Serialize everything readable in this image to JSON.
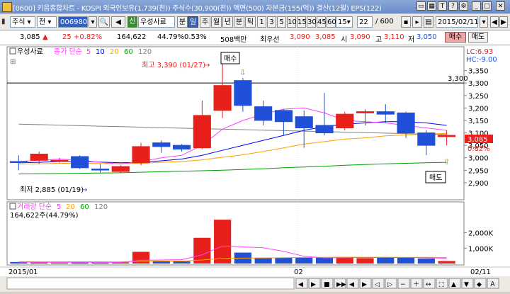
{
  "window": {
    "title": "[0600] 키움종합차트 - KOSPI 외국인보유(1,739(천)) 주식수(30,900(천)) 액면(500) 자본금(155(억)) 결산(12월) EPS(122)"
  },
  "toolbar": {
    "market": "주식",
    "prev": "전",
    "code": "006980",
    "new_badge": "신",
    "name": "우성사료",
    "period_minute": "분",
    "period_day": "일",
    "period_week": "주",
    "period_month": "월",
    "period_year": "년",
    "period_minute2": "분",
    "period_tick": "틱",
    "intervals": [
      "1",
      "3",
      "5",
      "10",
      "15",
      "30",
      "45",
      "60"
    ],
    "interval_value": "15",
    "count": "22",
    "total": "/ 600",
    "date": "2015/02/11"
  },
  "quote": {
    "price": "3,085",
    "change": "25",
    "change_pct": "+0.82%",
    "volume": "164,622",
    "vol_ratio": "44.79%",
    "turnover": "0.53%",
    "amount": "508백만",
    "bid_label": "최우선",
    "ask": "3,090",
    "bid": "3,085",
    "open_label": "시",
    "open": "3,090",
    "high_label": "고",
    "high": "3,110",
    "low_label": "저",
    "low": "3,050",
    "buy_button": "매수",
    "sell_button": "매도"
  },
  "price_panel": {
    "stock_label": "우성사료",
    "legend_prefix": "종가 단순",
    "ma_labels": [
      "5",
      "10",
      "20",
      "60",
      "120"
    ],
    "ma_colors": [
      "#ff40ff",
      "#0000ff",
      "#ffa000",
      "#00a000",
      "#808080"
    ],
    "lc": "LC:6.93",
    "hc": "HC:-9.00",
    "y_ticks": [
      "3,350",
      "3,300",
      "3,250",
      "3,200",
      "3,150",
      "3,100",
      "3,050",
      "3,000",
      "2,950",
      "2,900"
    ],
    "hline_label": "3,300",
    "high_note": "최고 3,390 (01/27)",
    "low_note": "최저 2,885 (01/19)",
    "buy_marker": "매수",
    "sell_marker": "매도",
    "current_price_tag": "3,085",
    "current_pct_tag": "0.82%"
  },
  "volume_panel": {
    "title": "거래량 단순",
    "ma_labels": [
      "5",
      "20",
      "60",
      "120"
    ],
    "ma_colors": [
      "#ff40ff",
      "#ffa000",
      "#00a000",
      "#808080"
    ],
    "info": "164,622주(44.79%)",
    "y_ticks": [
      "2,000K",
      "1,000K"
    ]
  },
  "x_axis": {
    "labels": [
      "2015/01",
      "02",
      "02/11"
    ]
  },
  "colors": {
    "up": "#e8201c",
    "down": "#2050d8",
    "accent": "#3a62b0"
  },
  "chart_data": {
    "type": "candlestick",
    "candles": [
      {
        "o": 2985,
        "h": 3010,
        "l": 2950,
        "c": 2985,
        "up": false
      },
      {
        "o": 2990,
        "h": 3025,
        "l": 2975,
        "c": 3015,
        "up": true
      },
      {
        "o": 2990,
        "h": 3000,
        "l": 2980,
        "c": 2990,
        "up": true
      },
      {
        "o": 3005,
        "h": 3010,
        "l": 2955,
        "c": 2960,
        "up": false
      },
      {
        "o": 2955,
        "h": 2975,
        "l": 2940,
        "c": 2955,
        "up": false
      },
      {
        "o": 2945,
        "h": 2970,
        "l": 2938,
        "c": 2965,
        "up": true
      },
      {
        "o": 2980,
        "h": 3060,
        "l": 2970,
        "c": 3045,
        "up": true
      },
      {
        "o": 3045,
        "h": 3070,
        "l": 3020,
        "c": 3060,
        "up": false
      },
      {
        "o": 3050,
        "h": 3055,
        "l": 3025,
        "c": 3035,
        "up": false
      },
      {
        "o": 3040,
        "h": 3230,
        "l": 3035,
        "c": 3170,
        "up": true
      },
      {
        "o": 3190,
        "h": 3390,
        "l": 3160,
        "c": 3290,
        "up": true
      },
      {
        "o": 3310,
        "h": 3320,
        "l": 3185,
        "c": 3210,
        "up": false
      },
      {
        "o": 3205,
        "h": 3230,
        "l": 3130,
        "c": 3150,
        "up": false
      },
      {
        "o": 3190,
        "h": 3195,
        "l": 3090,
        "c": 3145,
        "up": false
      },
      {
        "o": 3165,
        "h": 3190,
        "l": 3040,
        "c": 3120,
        "up": false
      },
      {
        "o": 3130,
        "h": 3260,
        "l": 3090,
        "c": 3100,
        "up": false
      },
      {
        "o": 3120,
        "h": 3185,
        "l": 3110,
        "c": 3175,
        "up": true
      },
      {
        "o": 3185,
        "h": 3195,
        "l": 3130,
        "c": 3180,
        "up": true
      },
      {
        "o": 3185,
        "h": 3215,
        "l": 3140,
        "c": 3175,
        "up": false
      },
      {
        "o": 3180,
        "h": 3185,
        "l": 3080,
        "c": 3100,
        "up": false
      },
      {
        "o": 3100,
        "h": 3110,
        "l": 3010,
        "c": 3050,
        "up": false
      },
      {
        "o": 3090,
        "h": 3110,
        "l": 3050,
        "c": 3085,
        "up": true
      }
    ],
    "volume": [
      {
        "v": 100,
        "up": false
      },
      {
        "v": 80,
        "up": true
      },
      {
        "v": 60,
        "up": true
      },
      {
        "v": 90,
        "up": false
      },
      {
        "v": 60,
        "up": false
      },
      {
        "v": 80,
        "up": true
      },
      {
        "v": 760,
        "up": true
      },
      {
        "v": 180,
        "up": false
      },
      {
        "v": 140,
        "up": false
      },
      {
        "v": 1670,
        "up": true
      },
      {
        "v": 2850,
        "up": true
      },
      {
        "v": 710,
        "up": false
      },
      {
        "v": 380,
        "up": false
      },
      {
        "v": 370,
        "up": false
      },
      {
        "v": 400,
        "up": false
      },
      {
        "v": 410,
        "up": false
      },
      {
        "v": 430,
        "up": true
      },
      {
        "v": 350,
        "up": true
      },
      {
        "v": 400,
        "up": false
      },
      {
        "v": 370,
        "up": false
      },
      {
        "v": 330,
        "up": false
      },
      {
        "v": 165,
        "up": true
      }
    ],
    "ma5": [
      2985,
      2990,
      2995,
      2990,
      2982,
      2975,
      2985,
      3000,
      3010,
      3050,
      3115,
      3150,
      3175,
      3195,
      3200,
      3180,
      3150,
      3145,
      3140,
      3130,
      3120,
      3110
    ],
    "ma10": [
      2980,
      2982,
      2985,
      2985,
      2983,
      2980,
      2982,
      2988,
      2995,
      3010,
      3030,
      3050,
      3070,
      3090,
      3110,
      3125,
      3135,
      3140,
      3145,
      3145,
      3140,
      3130
    ],
    "ma20": [
      2975,
      2976,
      2978,
      2978,
      2977,
      2976,
      2978,
      2982,
      2985,
      2992,
      3002,
      3012,
      3025,
      3040,
      3055,
      3065,
      3075,
      3080,
      3088,
      3092,
      3095,
      3098
    ],
    "ma60": [
      2935,
      2936,
      2937,
      2938,
      2939,
      2940,
      2942,
      2944,
      2946,
      2948,
      2950,
      2953,
      2956,
      2960,
      2963,
      2966,
      2970,
      2973,
      2976,
      2978,
      2980,
      2982
    ],
    "ma120": [
      3135,
      3133,
      3131,
      3129,
      3127,
      3125,
      3123,
      3121,
      3119,
      3117,
      3115,
      3113,
      3111,
      3109,
      3107,
      3105,
      3103,
      3101,
      3099,
      3097,
      3095,
      3093
    ],
    "vol_ma5": [
      90,
      85,
      80,
      82,
      78,
      74,
      210,
      230,
      250,
      570,
      1140,
      1080,
      1020,
      790,
      470,
      370,
      380,
      390,
      390,
      390,
      380,
      340
    ],
    "vol_ma20": [
      120,
      118,
      116,
      115,
      114,
      112,
      150,
      155,
      160,
      230,
      330,
      350,
      365,
      380,
      395,
      405,
      410,
      410,
      410,
      405,
      400,
      390
    ],
    "ylim": [
      2860,
      3400
    ],
    "vol_ylim": [
      0,
      2900
    ]
  }
}
